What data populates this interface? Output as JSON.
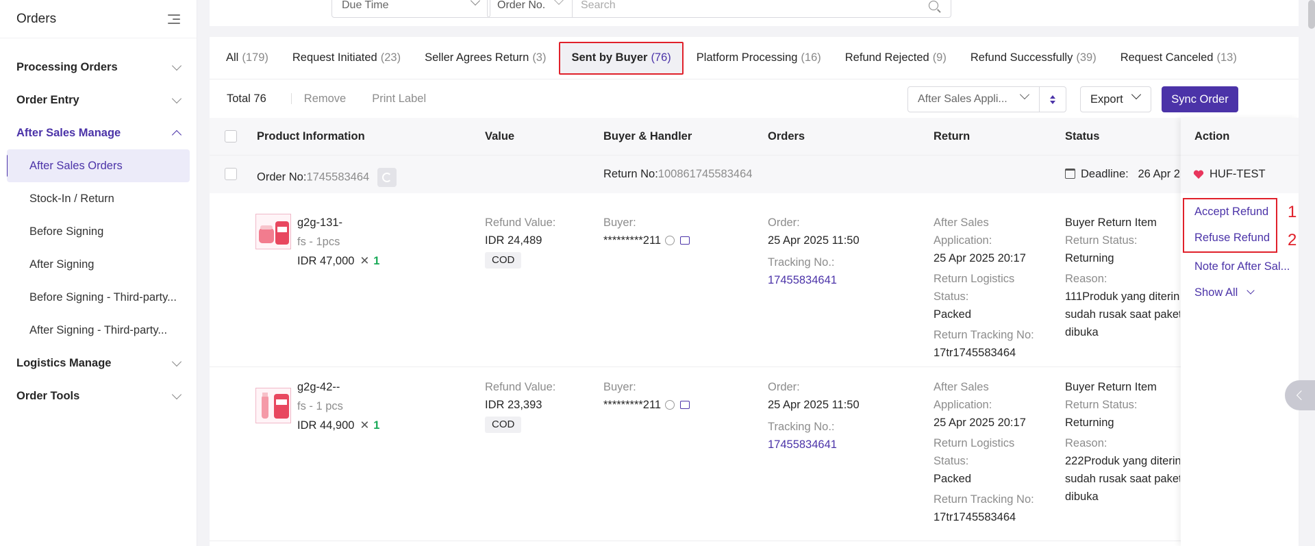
{
  "sidebar": {
    "title": "Orders",
    "groups": [
      {
        "label": "Processing Orders"
      },
      {
        "label": "Order Entry"
      },
      {
        "label": "After Sales Manage"
      },
      {
        "label": "Logistics Manage"
      },
      {
        "label": "Order Tools"
      }
    ],
    "items": [
      {
        "label": "After Sales Orders"
      },
      {
        "label": "Stock-In / Return"
      },
      {
        "label": "Before Signing"
      },
      {
        "label": "After Signing"
      },
      {
        "label": "Before Signing - Third-party..."
      },
      {
        "label": "After Signing - Third-party..."
      }
    ]
  },
  "filters": {
    "due_time": "Due Time",
    "order_no_select": "Order No.",
    "search_placeholder": "Search"
  },
  "tabs": [
    {
      "label": "All",
      "count": "(179)"
    },
    {
      "label": "Request Initiated",
      "count": "(23)"
    },
    {
      "label": "Seller Agrees Return",
      "count": "(3)"
    },
    {
      "label": "Sent by Buyer",
      "count": "(76)"
    },
    {
      "label": "Platform Processing",
      "count": "(16)"
    },
    {
      "label": "Refund Rejected",
      "count": "(9)"
    },
    {
      "label": "Refund Successfully",
      "count": "(39)"
    },
    {
      "label": "Request Canceled",
      "count": "(13)"
    }
  ],
  "toolbar": {
    "total": "Total 76",
    "remove": "Remove",
    "print_label": "Print Label",
    "sort_select": "After Sales Appli...",
    "export": "Export",
    "sync": "Sync Order"
  },
  "columns": {
    "product": "Product Information",
    "value": "Value",
    "buyer": "Buyer & Handler",
    "orders": "Orders",
    "return": "Return",
    "status": "Status",
    "action": "Action"
  },
  "order": {
    "order_no_label": "Order No:",
    "order_no": "1745583464",
    "return_no_label": "Return No:",
    "return_no": "100861745583464",
    "deadline_label": "Deadline:",
    "deadline": "26 Apr 2",
    "shop": "HUF-TEST"
  },
  "rows": [
    {
      "sku": "g2g-131-",
      "variant": "fs - 1pcs",
      "price": "IDR 47,000",
      "qty": "1",
      "refund_label": "Refund Value:",
      "refund": "IDR 24,489",
      "payment": "COD",
      "buyer_label": "Buyer:",
      "buyer": "*********211",
      "order_label": "Order:",
      "order_date": "25 Apr 2025 11:50",
      "tracking_label": "Tracking No.:",
      "tracking": "17455834641",
      "app_label_1": "After Sales",
      "app_label_2": "Application:",
      "app_date": "25 Apr 2025 20:17",
      "logi_label_1": "Return Logistics",
      "logi_label_2": "Status:",
      "logi_status": "Packed",
      "rtrack_label": "Return Tracking No:",
      "rtrack": "17tr1745583464",
      "status_title": "Buyer Return Item",
      "ret_status_label": "Return Status:",
      "ret_status": "Returning",
      "reason_label": "Reason:",
      "reason_1": "111Produk yang diterin",
      "reason_2": "sudah rusak saat paket",
      "reason_3": "dibuka"
    },
    {
      "sku": "g2g-42--",
      "variant": "fs - 1 pcs",
      "price": "IDR 44,900",
      "qty": "1",
      "refund_label": "Refund Value:",
      "refund": "IDR 23,393",
      "payment": "COD",
      "buyer_label": "Buyer:",
      "buyer": "*********211",
      "order_label": "Order:",
      "order_date": "25 Apr 2025 11:50",
      "tracking_label": "Tracking No.:",
      "tracking": "17455834641",
      "app_label_1": "After Sales",
      "app_label_2": "Application:",
      "app_date": "25 Apr 2025 20:17",
      "logi_label_1": "Return Logistics",
      "logi_label_2": "Status:",
      "logi_status": "Packed",
      "rtrack_label": "Return Tracking No:",
      "rtrack": "17tr1745583464",
      "status_title": "Buyer Return Item",
      "ret_status_label": "Return Status:",
      "ret_status": "Returning",
      "reason_label": "Reason:",
      "reason_1": "222Produk yang diterin",
      "reason_2": "sudah rusak saat paket",
      "reason_3": "dibuka"
    }
  ],
  "actions": {
    "accept": "Accept Refund",
    "refuse": "Refuse Refund",
    "note": "Note for After Sal...",
    "show_all": "Show All"
  },
  "annotations": {
    "one": "1",
    "two": "2"
  },
  "colors": {
    "accent": "#4b33a8",
    "highlight": "#e0202a",
    "qty": "#18a957"
  }
}
